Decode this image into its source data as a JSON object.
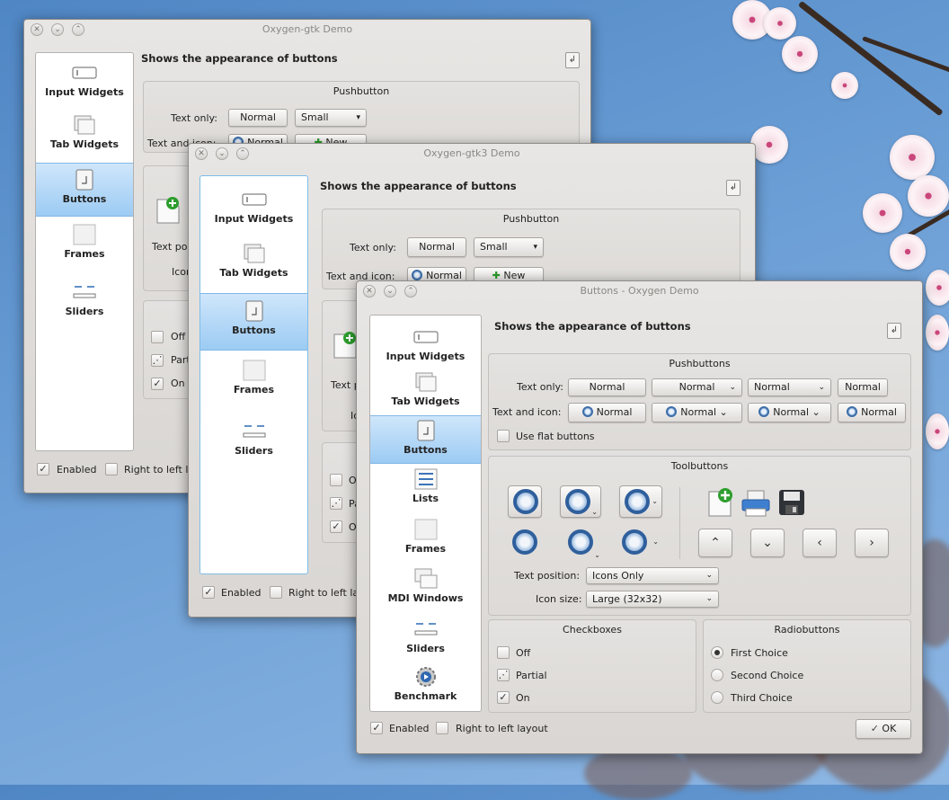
{
  "windows": {
    "gtk2": {
      "title": "Oxygen-gtk Demo",
      "heading": "Shows the appearance of buttons",
      "sidebar": [
        "Input Widgets",
        "Tab Widgets",
        "Buttons",
        "Frames",
        "Sliders"
      ],
      "pushbutton_title": "Pushbutton",
      "text_only_label": "Text only:",
      "text_icon_label": "Text and icon:",
      "normal": "Normal",
      "small": "Small",
      "new": "New",
      "text_pos_frag": "Text po",
      "icon_frag": "Icon",
      "check_off": "Off",
      "check_partial_frag": "Part",
      "check_on": "On",
      "enabled": "Enabled",
      "rtl_frag": "Right to left l"
    },
    "gtk3": {
      "title": "Oxygen-gtk3 Demo",
      "heading": "Shows the appearance of buttons",
      "sidebar": [
        "Input Widgets",
        "Tab Widgets",
        "Buttons",
        "Frames",
        "Sliders"
      ],
      "pushbutton_title": "Pushbutton",
      "text_only_label": "Text only:",
      "text_icon_label": "Text and icon:",
      "normal": "Normal",
      "small": "Small",
      "new": "New",
      "text_pos_frag": "Text p",
      "icon_frag": "Ic",
      "check_off_frag": "O",
      "check_partial_frag": "Pa",
      "check_on_frag": "O",
      "enabled": "Enabled",
      "rtl_frag": "Right to left la"
    },
    "qt": {
      "title": "Buttons - Oxygen Demo",
      "heading": "Shows the appearance of buttons",
      "sidebar": [
        "Input Widgets",
        "Tab Widgets",
        "Buttons",
        "Lists",
        "Frames",
        "MDI Windows",
        "Sliders",
        "Benchmark"
      ],
      "pushbuttons_title": "Pushbuttons",
      "text_only_label": "Text only:",
      "text_icon_label": "Text and icon:",
      "normal": "Normal",
      "flat_label": "Use flat buttons",
      "toolbuttons_title": "Toolbuttons",
      "text_position_label": "Text position:",
      "text_position_value": "Icons Only",
      "icon_size_label": "Icon size:",
      "icon_size_value": "Large (32x32)",
      "checkboxes_title": "Checkboxes",
      "check_off": "Off",
      "check_partial": "Partial",
      "check_on": "On",
      "radiobuttons_title": "Radiobuttons",
      "radio_1": "First Choice",
      "radio_2": "Second Choice",
      "radio_3": "Third Choice",
      "enabled": "Enabled",
      "rtl": "Right to left layout",
      "ok": "OK"
    }
  },
  "icons": {
    "close": "✕",
    "minimize": "⌄",
    "maximize": "⌃",
    "check": "✓",
    "partial": "⋰",
    "up": "⌃",
    "down": "⌄",
    "left": "‹",
    "right": "›",
    "combo_arrow": "▾"
  }
}
